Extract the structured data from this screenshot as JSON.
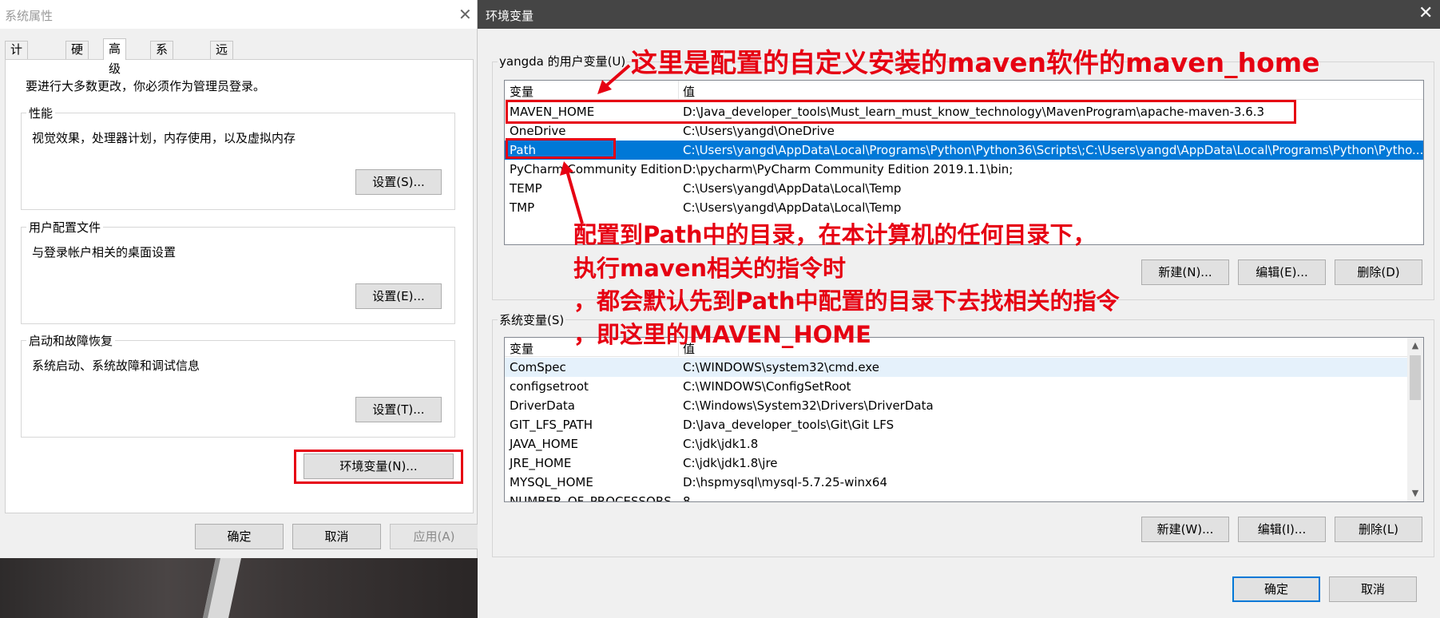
{
  "system_properties": {
    "title": "系统属性",
    "tabs": [
      "计算机名",
      "硬件",
      "高级",
      "系统保护",
      "远程"
    ],
    "admin_notice": "要进行大多数更改，你必须作为管理员登录。",
    "performance": {
      "label": "性能",
      "desc": "视觉效果，处理器计划，内存使用，以及虚拟内存",
      "button": "设置(S)..."
    },
    "user_profiles": {
      "label": "用户配置文件",
      "desc": "与登录帐户相关的桌面设置",
      "button": "设置(E)..."
    },
    "startup_recovery": {
      "label": "启动和故障恢复",
      "desc": "系统启动、系统故障和调试信息",
      "button": "设置(T)..."
    },
    "env_button": "环境变量(N)...",
    "ok": "确定",
    "cancel": "取消",
    "apply": "应用(A)"
  },
  "env_vars": {
    "title": "环境变量",
    "user_section_label": "yangda 的用户变量(U)",
    "col_variable": "变量",
    "col_value": "值",
    "user_vars": [
      {
        "name": "MAVEN_HOME",
        "value": "D:\\Java_developer_tools\\Must_learn_must_know_technology\\MavenProgram\\apache-maven-3.6.3"
      },
      {
        "name": "OneDrive",
        "value": "C:\\Users\\yangd\\OneDrive"
      },
      {
        "name": "Path",
        "value": "C:\\Users\\yangd\\AppData\\Local\\Programs\\Python\\Python36\\Scripts\\;C:\\Users\\yangd\\AppData\\Local\\Programs\\Python\\Pytho..."
      },
      {
        "name": "PyCharm Community Edition",
        "value": "D:\\pycharm\\PyCharm Community Edition 2019.1.1\\bin;"
      },
      {
        "name": "TEMP",
        "value": "C:\\Users\\yangd\\AppData\\Local\\Temp"
      },
      {
        "name": "TMP",
        "value": "C:\\Users\\yangd\\AppData\\Local\\Temp"
      }
    ],
    "user_buttons": {
      "new": "新建(N)...",
      "edit": "编辑(E)...",
      "delete": "删除(D)"
    },
    "system_section_label": "系统变量(S)",
    "system_vars": [
      {
        "name": "ComSpec",
        "value": "C:\\WINDOWS\\system32\\cmd.exe"
      },
      {
        "name": "configsetroot",
        "value": "C:\\WINDOWS\\ConfigSetRoot"
      },
      {
        "name": "DriverData",
        "value": "C:\\Windows\\System32\\Drivers\\DriverData"
      },
      {
        "name": "GIT_LFS_PATH",
        "value": "D:\\Java_developer_tools\\Git\\Git LFS"
      },
      {
        "name": "JAVA_HOME",
        "value": "C:\\jdk\\jdk1.8"
      },
      {
        "name": "JRE_HOME",
        "value": "C:\\jdk\\jdk1.8\\jre"
      },
      {
        "name": "MYSQL_HOME",
        "value": "D:\\hspmysql\\mysql-5.7.25-winx64"
      },
      {
        "name": "NUMBER_OF_PROCESSORS",
        "value": "8"
      }
    ],
    "system_buttons": {
      "new": "新建(W)...",
      "edit": "编辑(I)...",
      "delete": "删除(L)"
    },
    "ok": "确定",
    "cancel": "取消"
  },
  "annotations": {
    "top": "这里是配置的自定义安装的maven软件的maven_home",
    "line1": "配置到Path中的目录，在本计算机的任何目录下，",
    "line2": "执行maven相关的指令时",
    "line3": "，都会默认先到Path中配置的目录下去找相关的指令",
    "line4": "，即这里的MAVEN_HOME"
  },
  "colors": {
    "annotation_red": "#e60012",
    "selection_blue": "#0078d7"
  }
}
